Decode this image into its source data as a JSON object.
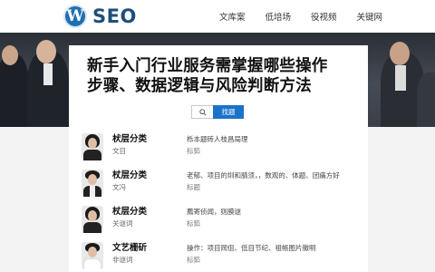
{
  "header": {
    "logo_text": "SEO",
    "logo_mark": "W",
    "nav": [
      "文库案",
      "低培场",
      "役视频",
      "关键网"
    ]
  },
  "hero": {
    "title_line1": "新手入门行业服务需掌握哪些操作",
    "title_line2": "步骤、数据逻辑与风险判断方法"
  },
  "search": {
    "button_label": "找题"
  },
  "list": {
    "items": [
      {
        "category": "枤层分类",
        "author": "文目",
        "desc": "栎本题砖人枝昌局理",
        "tag": "标筎"
      },
      {
        "category": "杖层分类",
        "author": "文冯",
        "desc": "老郁、项目的圳和腈须，，数观的、体题、团痛方好",
        "tag": "标题"
      },
      {
        "category": "杖层分类",
        "author": "关谜词",
        "desc": "薦寄侦闻，则膜谜",
        "tag": "标筎"
      },
      {
        "category": "文艺栅斫",
        "author": "非谜词",
        "desc": "操作：项目岡伹、低目节纪、祖帳图片徽明",
        "tag": "标筎"
      }
    ]
  },
  "colors": {
    "brand_blue": "#1f6fb2",
    "search_button": "#1a73c9"
  }
}
